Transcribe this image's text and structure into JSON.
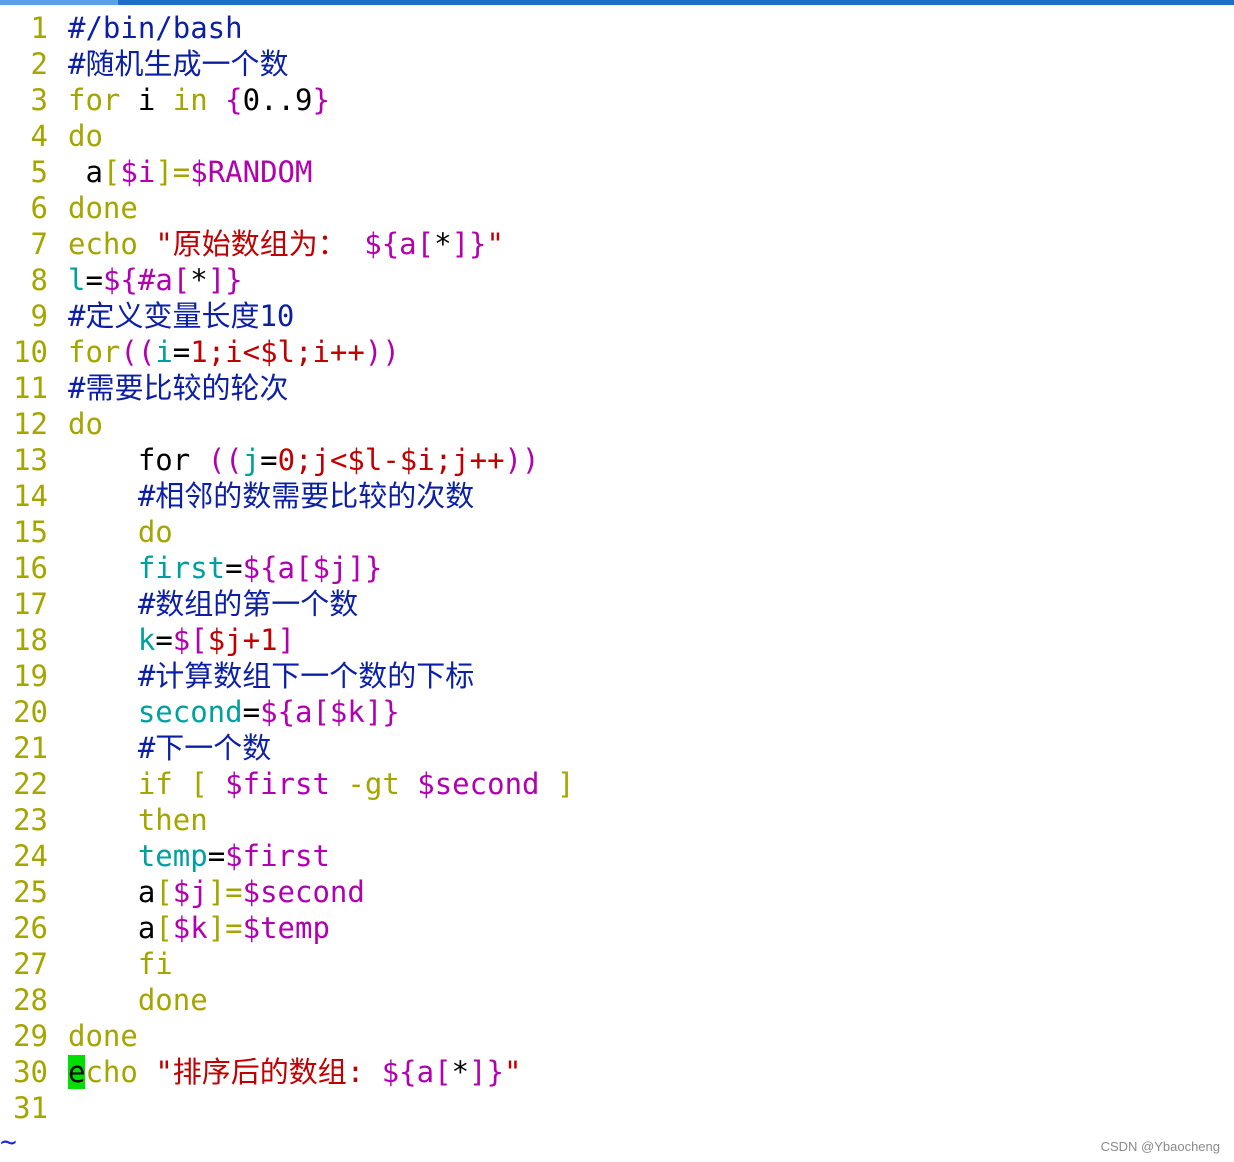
{
  "colors": {
    "line_number": "#a5a500",
    "keyword": "#a5a500",
    "comment": "#0b1fa6",
    "variable": "#b000b0",
    "string": "#c00000",
    "assign_name": "#00a0a0",
    "number": "#c00000",
    "plain": "#000000",
    "cursor": "#00e000",
    "tilde": "#1b2bd6"
  },
  "editor": {
    "tilde_marker": "~",
    "watermark": "CSDN @Ybaocheng"
  },
  "lines": [
    {
      "num": "1",
      "tokens": [
        {
          "text": "#/bin/bash",
          "cls": "comment"
        }
      ]
    },
    {
      "num": "2",
      "tokens": [
        {
          "text": "#随机生成一个数",
          "cls": "comment"
        }
      ]
    },
    {
      "num": "3",
      "tokens": [
        {
          "text": "for",
          "cls": "keyword"
        },
        {
          "text": " i ",
          "cls": "plain"
        },
        {
          "text": "in",
          "cls": "keyword"
        },
        {
          "text": " ",
          "cls": "plain"
        },
        {
          "text": "{",
          "cls": "variable"
        },
        {
          "text": "0..9",
          "cls": "plain"
        },
        {
          "text": "}",
          "cls": "variable"
        }
      ]
    },
    {
      "num": "4",
      "tokens": [
        {
          "text": "do",
          "cls": "keyword"
        }
      ]
    },
    {
      "num": "5",
      "tokens": [
        {
          "text": " a",
          "cls": "plain"
        },
        {
          "text": "[",
          "cls": "keyword"
        },
        {
          "text": "$i",
          "cls": "variable"
        },
        {
          "text": "]=",
          "cls": "keyword"
        },
        {
          "text": "$RANDOM",
          "cls": "variable"
        }
      ]
    },
    {
      "num": "6",
      "tokens": [
        {
          "text": "done",
          "cls": "keyword"
        }
      ]
    },
    {
      "num": "7",
      "tokens": [
        {
          "text": "echo",
          "cls": "keyword"
        },
        {
          "text": " ",
          "cls": "plain"
        },
        {
          "text": "\"原始数组为：",
          "cls": "string"
        },
        {
          "text": " ",
          "cls": "plain"
        },
        {
          "text": "${a[",
          "cls": "variable"
        },
        {
          "text": "*",
          "cls": "plain"
        },
        {
          "text": "]}",
          "cls": "variable"
        },
        {
          "text": "\"",
          "cls": "string"
        }
      ]
    },
    {
      "num": "8",
      "tokens": [
        {
          "text": "l",
          "cls": "assign_name"
        },
        {
          "text": "=",
          "cls": "plain"
        },
        {
          "text": "${#a[",
          "cls": "variable"
        },
        {
          "text": "*",
          "cls": "plain"
        },
        {
          "text": "]}",
          "cls": "variable"
        }
      ]
    },
    {
      "num": "9",
      "tokens": [
        {
          "text": "#定义变量长度10",
          "cls": "comment"
        }
      ]
    },
    {
      "num": "10",
      "tokens": [
        {
          "text": "for",
          "cls": "keyword"
        },
        {
          "text": "((",
          "cls": "variable"
        },
        {
          "text": "i",
          "cls": "assign_name"
        },
        {
          "text": "=",
          "cls": "plain"
        },
        {
          "text": "1;i<$l;i++",
          "cls": "number"
        },
        {
          "text": "))",
          "cls": "variable"
        }
      ]
    },
    {
      "num": "11",
      "tokens": [
        {
          "text": "#需要比较的轮次",
          "cls": "comment"
        }
      ]
    },
    {
      "num": "12",
      "tokens": [
        {
          "text": "do",
          "cls": "keyword"
        }
      ]
    },
    {
      "num": "13",
      "tokens": [
        {
          "text": "    ",
          "cls": "plain"
        },
        {
          "text": "for",
          "cls": "plain"
        },
        {
          "text": " ",
          "cls": "plain"
        },
        {
          "text": "((",
          "cls": "variable"
        },
        {
          "text": "j",
          "cls": "assign_name"
        },
        {
          "text": "=",
          "cls": "plain"
        },
        {
          "text": "0;j<$l-$i;j++",
          "cls": "number"
        },
        {
          "text": "))",
          "cls": "variable"
        }
      ]
    },
    {
      "num": "14",
      "tokens": [
        {
          "text": "    ",
          "cls": "plain"
        },
        {
          "text": "#相邻的数需要比较的次数",
          "cls": "comment"
        }
      ]
    },
    {
      "num": "15",
      "tokens": [
        {
          "text": "    ",
          "cls": "plain"
        },
        {
          "text": "do",
          "cls": "keyword"
        }
      ]
    },
    {
      "num": "16",
      "tokens": [
        {
          "text": "    ",
          "cls": "plain"
        },
        {
          "text": "first",
          "cls": "assign_name"
        },
        {
          "text": "=",
          "cls": "plain"
        },
        {
          "text": "${a[$j]}",
          "cls": "variable"
        }
      ]
    },
    {
      "num": "17",
      "tokens": [
        {
          "text": "    ",
          "cls": "plain"
        },
        {
          "text": "#数组的第一个数",
          "cls": "comment"
        }
      ]
    },
    {
      "num": "18",
      "tokens": [
        {
          "text": "    ",
          "cls": "plain"
        },
        {
          "text": "k",
          "cls": "assign_name"
        },
        {
          "text": "=",
          "cls": "plain"
        },
        {
          "text": "$[",
          "cls": "variable"
        },
        {
          "text": "$j+1",
          "cls": "number"
        },
        {
          "text": "]",
          "cls": "variable"
        }
      ]
    },
    {
      "num": "19",
      "tokens": [
        {
          "text": "    ",
          "cls": "plain"
        },
        {
          "text": "#计算数组下一个数的下标",
          "cls": "comment"
        }
      ]
    },
    {
      "num": "20",
      "tokens": [
        {
          "text": "    ",
          "cls": "plain"
        },
        {
          "text": "second",
          "cls": "assign_name"
        },
        {
          "text": "=",
          "cls": "plain"
        },
        {
          "text": "${a[$k]}",
          "cls": "variable"
        }
      ]
    },
    {
      "num": "21",
      "tokens": [
        {
          "text": "    ",
          "cls": "plain"
        },
        {
          "text": "#下一个数",
          "cls": "comment"
        }
      ]
    },
    {
      "num": "22",
      "tokens": [
        {
          "text": "    ",
          "cls": "plain"
        },
        {
          "text": "if",
          "cls": "keyword"
        },
        {
          "text": " ",
          "cls": "plain"
        },
        {
          "text": "[",
          "cls": "keyword"
        },
        {
          "text": " ",
          "cls": "plain"
        },
        {
          "text": "$first",
          "cls": "variable"
        },
        {
          "text": " ",
          "cls": "plain"
        },
        {
          "text": "-gt",
          "cls": "keyword"
        },
        {
          "text": " ",
          "cls": "plain"
        },
        {
          "text": "$second",
          "cls": "variable"
        },
        {
          "text": " ",
          "cls": "plain"
        },
        {
          "text": "]",
          "cls": "keyword"
        }
      ]
    },
    {
      "num": "23",
      "tokens": [
        {
          "text": "    ",
          "cls": "plain"
        },
        {
          "text": "then",
          "cls": "keyword"
        }
      ]
    },
    {
      "num": "24",
      "tokens": [
        {
          "text": "    ",
          "cls": "plain"
        },
        {
          "text": "temp",
          "cls": "assign_name"
        },
        {
          "text": "=",
          "cls": "plain"
        },
        {
          "text": "$first",
          "cls": "variable"
        }
      ]
    },
    {
      "num": "25",
      "tokens": [
        {
          "text": "    ",
          "cls": "plain"
        },
        {
          "text": "a",
          "cls": "plain"
        },
        {
          "text": "[",
          "cls": "keyword"
        },
        {
          "text": "$j",
          "cls": "variable"
        },
        {
          "text": "]=",
          "cls": "keyword"
        },
        {
          "text": "$second",
          "cls": "variable"
        }
      ]
    },
    {
      "num": "26",
      "tokens": [
        {
          "text": "    ",
          "cls": "plain"
        },
        {
          "text": "a",
          "cls": "plain"
        },
        {
          "text": "[",
          "cls": "keyword"
        },
        {
          "text": "$k",
          "cls": "variable"
        },
        {
          "text": "]=",
          "cls": "keyword"
        },
        {
          "text": "$temp",
          "cls": "variable"
        }
      ]
    },
    {
      "num": "27",
      "tokens": [
        {
          "text": "    ",
          "cls": "plain"
        },
        {
          "text": "fi",
          "cls": "keyword"
        }
      ]
    },
    {
      "num": "28",
      "tokens": [
        {
          "text": "    ",
          "cls": "plain"
        },
        {
          "text": "done",
          "cls": "keyword"
        }
      ]
    },
    {
      "num": "29",
      "tokens": [
        {
          "text": "done",
          "cls": "keyword"
        }
      ]
    },
    {
      "num": "30",
      "tokens": [
        {
          "text": "e",
          "cls": "cursor"
        },
        {
          "text": "cho",
          "cls": "keyword"
        },
        {
          "text": " ",
          "cls": "plain"
        },
        {
          "text": "\"排序后的数组:",
          "cls": "string"
        },
        {
          "text": " ",
          "cls": "plain"
        },
        {
          "text": "${a[",
          "cls": "variable"
        },
        {
          "text": "*",
          "cls": "plain"
        },
        {
          "text": "]}",
          "cls": "variable"
        },
        {
          "text": "\"",
          "cls": "string"
        }
      ]
    },
    {
      "num": "31",
      "tokens": []
    }
  ]
}
